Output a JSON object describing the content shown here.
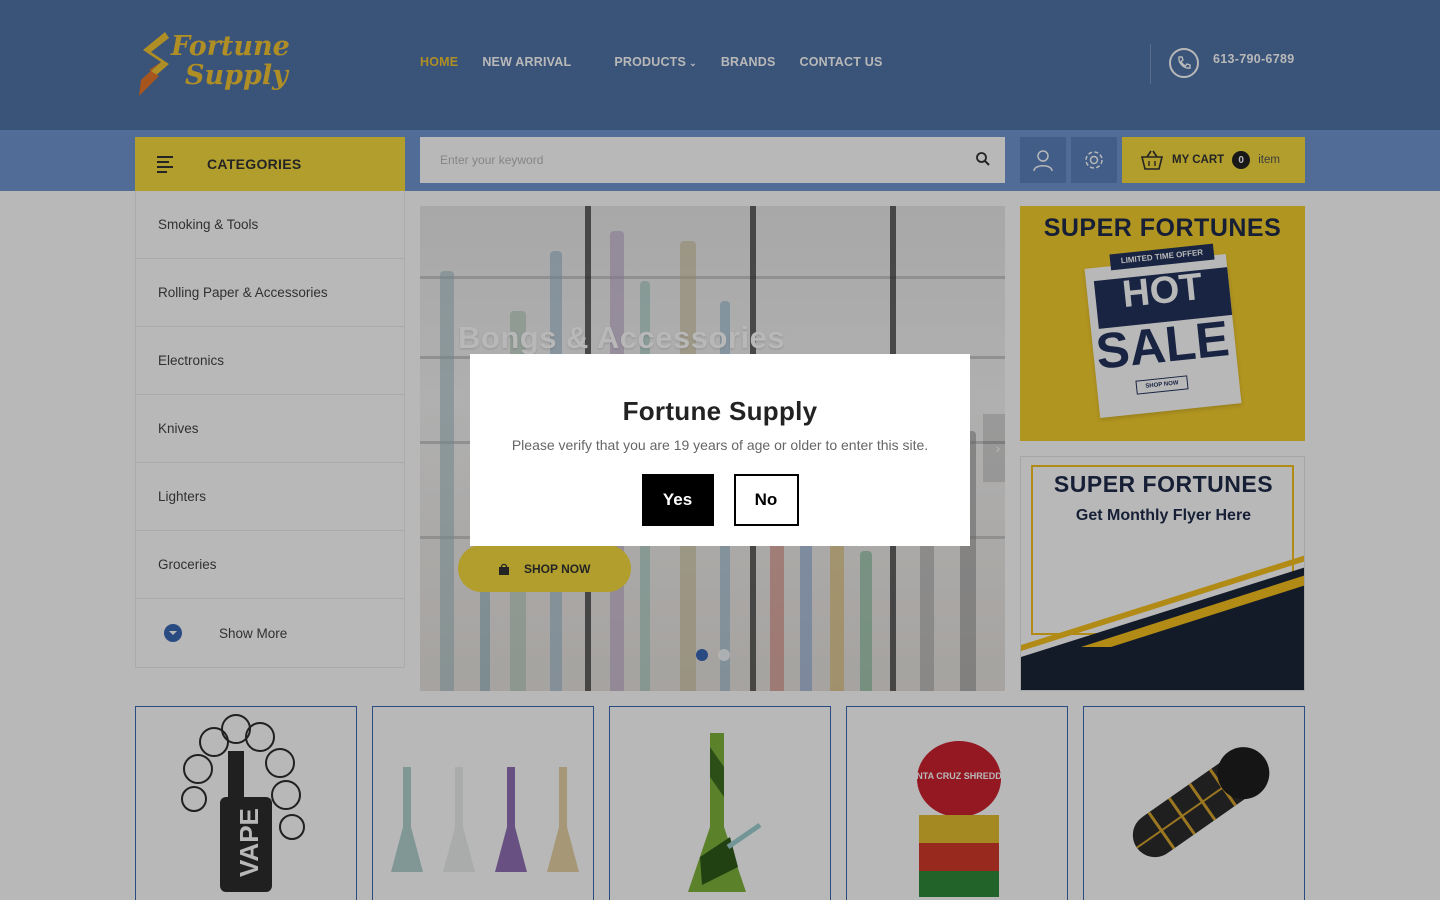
{
  "brand": {
    "logo_line1": "Fortune",
    "logo_line2": "Supply",
    "logo_colors": {
      "gold": "#f2c534",
      "orange": "#e8772c"
    }
  },
  "nav": {
    "items": [
      {
        "label": "HOME",
        "active": true
      },
      {
        "label": "NEW ARRIVAL",
        "active": false
      },
      {
        "label": "PRODUCTS",
        "active": false,
        "has_dropdown": true
      },
      {
        "label": "BRANDS",
        "active": false
      },
      {
        "label": "CONTACT US",
        "active": false
      }
    ]
  },
  "contact": {
    "phone": "613-790-6789",
    "icon": "phone-icon"
  },
  "categories_button": {
    "label": "CATEGORIES",
    "icon": "menu-lines-icon"
  },
  "search": {
    "placeholder": "Enter your keyword",
    "value": "",
    "icon": "search-icon"
  },
  "header_icons": {
    "account": "user-icon",
    "settings": "gear-icon"
  },
  "cart": {
    "label": "MY CART",
    "count": "0",
    "unit": "item",
    "icon": "basket-icon"
  },
  "sidebar": {
    "items": [
      {
        "label": "Smoking & Tools"
      },
      {
        "label": "Rolling Paper & Accessories"
      },
      {
        "label": "Electronics"
      },
      {
        "label": "Knives"
      },
      {
        "label": "Lighters"
      },
      {
        "label": "Groceries"
      }
    ],
    "show_more": "Show More"
  },
  "hero": {
    "title": "Bongs & Accessories",
    "button_label": "SHOP NOW",
    "next_icon": "chevron-right-icon",
    "slide_count": 2,
    "active_slide": 1
  },
  "banners": {
    "hot_sale": {
      "heading": "SUPER FORTUNES",
      "ribbon": "LIMITED TIME OFFER",
      "hot": "HOT",
      "sale": "SALE",
      "shop": "SHOP NOW"
    },
    "flyer": {
      "heading": "SUPER FORTUNES",
      "subheading": "Get Monthly Flyer Here"
    }
  },
  "product_tiles": [
    {
      "name": "vape",
      "text": "VAPE"
    },
    {
      "name": "beaker-bongs",
      "text": ""
    },
    {
      "name": "silicone-bong",
      "text": ""
    },
    {
      "name": "grinder",
      "text": "SANTA CRUZ SHREDDER"
    },
    {
      "name": "glass-pipe",
      "text": ""
    }
  ],
  "colors": {
    "header_blue": "#4f73a8",
    "accent_yellow": "#f5db3f",
    "accent_blue": "#3a69b5"
  },
  "modal": {
    "title": "Fortune Supply",
    "message": "Please verify that you are 19 years of age or older to enter this site.",
    "yes_label": "Yes",
    "no_label": "No"
  }
}
